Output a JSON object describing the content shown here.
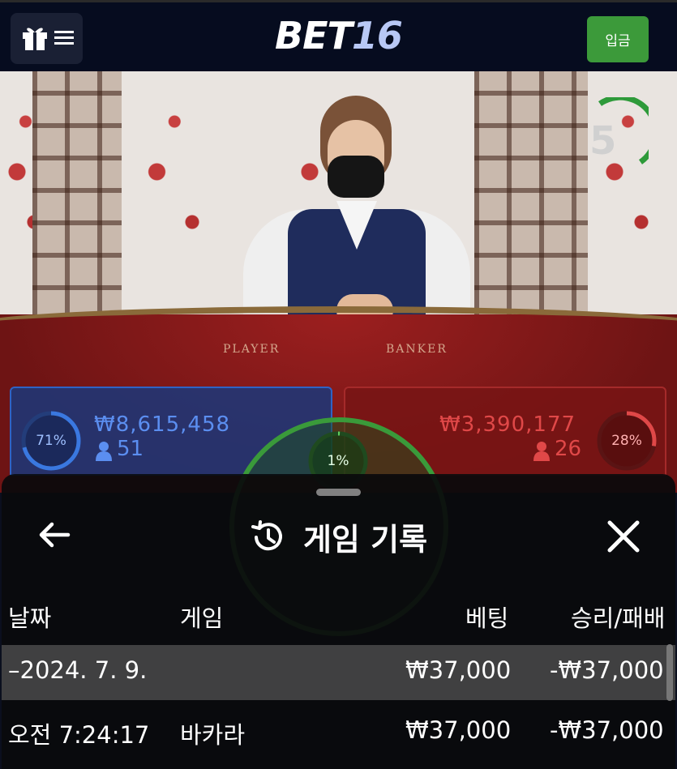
{
  "header": {
    "logo_bet": "BET",
    "logo_num": "16",
    "deposit_label": "입금",
    "menu_icons": [
      "gift-icon",
      "hamburger-icon"
    ]
  },
  "game": {
    "countdown": "5",
    "table_labels": {
      "player": "PLAYER",
      "banker": "BANKER"
    },
    "player": {
      "percent": "71%",
      "amount": "₩8,615,458",
      "count": "51",
      "color": "#2f63c5"
    },
    "banker": {
      "percent": "28%",
      "amount": "₩3,390,177",
      "count": "26",
      "color": "#d83a3a"
    },
    "tie": {
      "percent": "1%",
      "color": "#3a9a3a"
    }
  },
  "history_sheet": {
    "title": "게임 기록",
    "icons": {
      "back": "arrow-left-icon",
      "title": "history-icon",
      "close": "close-icon"
    },
    "columns": {
      "date": "날짜",
      "game": "게임",
      "bet": "베팅",
      "result": "승리/패배"
    },
    "rows": [
      {
        "date": "–2024. 7. 9.",
        "game": "",
        "bet": "₩37,000",
        "result": "-₩37,000"
      },
      {
        "date": "오전 7:24:17",
        "game": "바카라",
        "bet": "₩37,000",
        "result": "-₩37,000"
      }
    ]
  }
}
